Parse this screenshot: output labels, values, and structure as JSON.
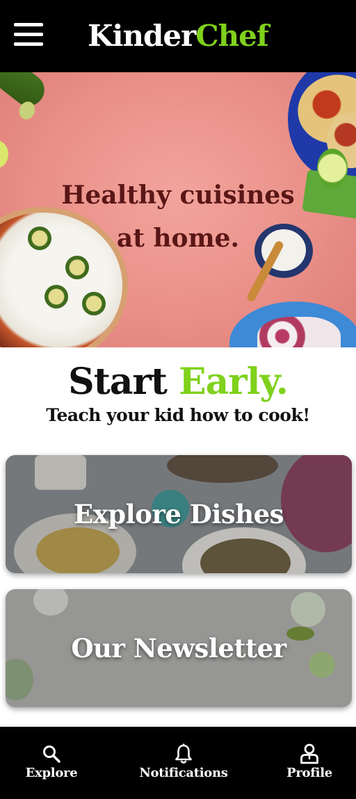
{
  "header": {
    "brand_part1": "Kinder",
    "brand_part2": "Chef",
    "menu_icon": "hamburger-menu-icon"
  },
  "hero": {
    "line1": "Healthy cuisines",
    "line2": "at home."
  },
  "tagline": {
    "word1": "Start",
    "word2": "Early.",
    "subtitle": "Teach your kid how to cook!"
  },
  "cards": {
    "explore": "Explore Dishes",
    "newsletter": "Our Newsletter"
  },
  "bottom_nav": {
    "items": [
      {
        "label": "Explore",
        "icon": "search-icon"
      },
      {
        "label": "Notifications",
        "icon": "bell-icon"
      },
      {
        "label": "Profile",
        "icon": "person-icon"
      }
    ]
  },
  "colors": {
    "brand_green": "#7fd11c",
    "header_bg": "#000000",
    "hero_text": "#5a1616"
  }
}
